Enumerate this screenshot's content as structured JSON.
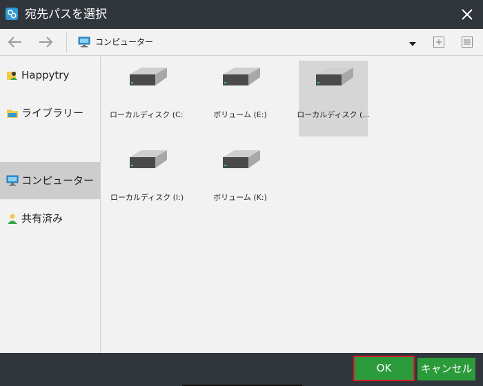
{
  "window": {
    "title": "宛先パスを選択"
  },
  "toolbar": {
    "location": "コンピューター"
  },
  "sidebar": {
    "items": [
      {
        "label": "Happytry",
        "icon": "user-folder-icon",
        "selected": false
      },
      {
        "label": "ライブラリー",
        "icon": "library-icon",
        "selected": false
      },
      {
        "label": "コンピューター",
        "icon": "computer-icon",
        "selected": true
      },
      {
        "label": "共有済み",
        "icon": "shared-user-icon",
        "selected": false
      }
    ]
  },
  "drives": [
    {
      "label": "ローカルディスク (C:)",
      "icon": "hard-drive-icon",
      "selected": false
    },
    {
      "label": "ボリューム (E:)",
      "icon": "hard-drive-icon",
      "selected": false
    },
    {
      "label": "ローカルディスク (...",
      "icon": "hard-drive-icon",
      "selected": true
    },
    {
      "label": "ローカルディスク (I:)",
      "icon": "hard-drive-icon",
      "selected": false
    },
    {
      "label": "ボリューム (K:)",
      "icon": "hard-drive-icon",
      "selected": false
    }
  ],
  "footer": {
    "ok_label": "OK",
    "cancel_label": "キャンセル"
  },
  "colors": {
    "titlebar": "#30363c",
    "panel": "#f2f2f2",
    "accent_green": "#2b9a3b",
    "highlight_red": "#d0202a",
    "app_icon_blue": "#2f9ad6"
  }
}
